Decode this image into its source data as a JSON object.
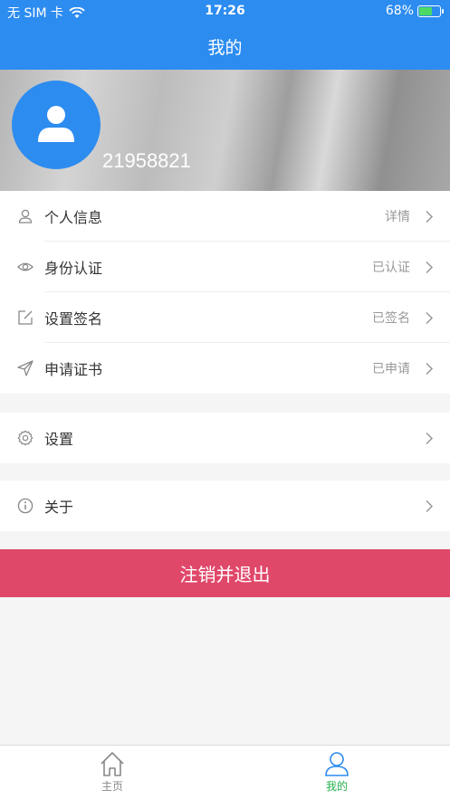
{
  "status_bar": {
    "carrier": "无 SIM 卡",
    "time": "17:26",
    "battery_percent": "68%",
    "battery_level": 0.68
  },
  "nav": {
    "title": "我的"
  },
  "profile": {
    "user_id": "21958821"
  },
  "menu_group_1": [
    {
      "label": "个人信息",
      "value": "详情",
      "icon": "person-icon"
    },
    {
      "label": "身份认证",
      "value": "已认证",
      "icon": "eye-icon"
    },
    {
      "label": "设置签名",
      "value": "已签名",
      "icon": "edit-icon"
    },
    {
      "label": "申请证书",
      "value": "已申请",
      "icon": "send-icon"
    }
  ],
  "menu_group_2": [
    {
      "label": "设置",
      "icon": "gear-icon"
    }
  ],
  "menu_group_3": [
    {
      "label": "关于",
      "icon": "info-icon"
    }
  ],
  "logout_label": "注销并退出",
  "tabbar": {
    "home_label": "主页",
    "mine_label": "我的",
    "active_color": "#22b14c"
  },
  "colors": {
    "primary": "#2d8cf0",
    "logout": "#e0486a"
  }
}
